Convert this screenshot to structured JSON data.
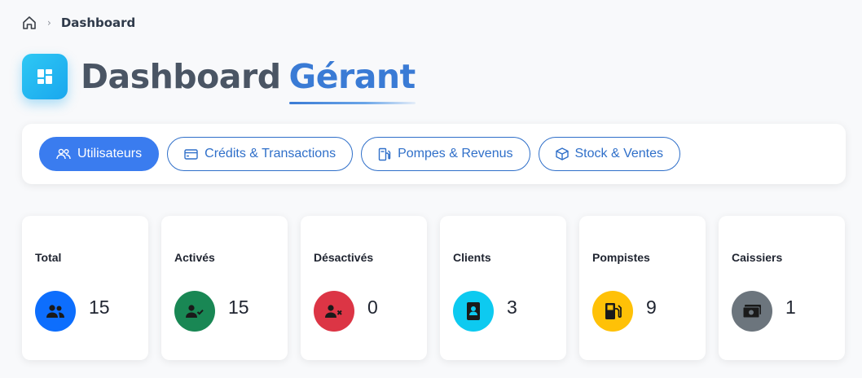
{
  "breadcrumb": {
    "separator": "›",
    "current": "Dashboard"
  },
  "header": {
    "title_main": "Dashboard",
    "title_accent": "Gérant"
  },
  "tabs": [
    {
      "label": "Utilisateurs",
      "icon": "users-icon",
      "active": true
    },
    {
      "label": "Crédits & Transactions",
      "icon": "credit-card-icon",
      "active": false
    },
    {
      "label": "Pompes & Revenus",
      "icon": "fuel-pump-icon",
      "active": false
    },
    {
      "label": "Stock & Ventes",
      "icon": "box-icon",
      "active": false
    }
  ],
  "stats": [
    {
      "label": "Total",
      "value": "15",
      "color": "#0d6efd",
      "icon": "users-icon"
    },
    {
      "label": "Activés",
      "value": "15",
      "color": "#198754",
      "icon": "user-check-icon"
    },
    {
      "label": "Désactivés",
      "value": "0",
      "color": "#dc3545",
      "icon": "user-x-icon"
    },
    {
      "label": "Clients",
      "value": "3",
      "color": "#0dcaf0",
      "icon": "contact-book-icon"
    },
    {
      "label": "Pompistes",
      "value": "9",
      "color": "#ffc107",
      "icon": "fuel-pump-icon"
    },
    {
      "label": "Caissiers",
      "value": "1",
      "color": "#6c757d",
      "icon": "cash-icon"
    }
  ]
}
